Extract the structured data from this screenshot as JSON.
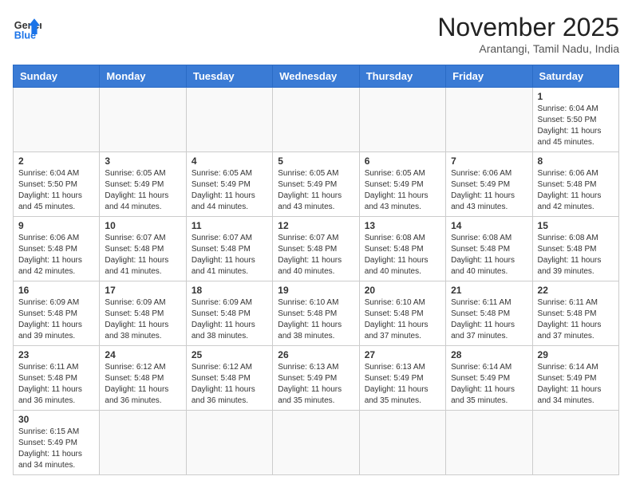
{
  "header": {
    "logo_general": "General",
    "logo_blue": "Blue",
    "month_title": "November 2025",
    "location": "Arantangi, Tamil Nadu, India"
  },
  "days_of_week": [
    "Sunday",
    "Monday",
    "Tuesday",
    "Wednesday",
    "Thursday",
    "Friday",
    "Saturday"
  ],
  "weeks": [
    [
      {
        "day": "",
        "info": ""
      },
      {
        "day": "",
        "info": ""
      },
      {
        "day": "",
        "info": ""
      },
      {
        "day": "",
        "info": ""
      },
      {
        "day": "",
        "info": ""
      },
      {
        "day": "",
        "info": ""
      },
      {
        "day": "1",
        "info": "Sunrise: 6:04 AM\nSunset: 5:50 PM\nDaylight: 11 hours and 45 minutes."
      }
    ],
    [
      {
        "day": "2",
        "info": "Sunrise: 6:04 AM\nSunset: 5:50 PM\nDaylight: 11 hours and 45 minutes."
      },
      {
        "day": "3",
        "info": "Sunrise: 6:05 AM\nSunset: 5:49 PM\nDaylight: 11 hours and 44 minutes."
      },
      {
        "day": "4",
        "info": "Sunrise: 6:05 AM\nSunset: 5:49 PM\nDaylight: 11 hours and 44 minutes."
      },
      {
        "day": "5",
        "info": "Sunrise: 6:05 AM\nSunset: 5:49 PM\nDaylight: 11 hours and 43 minutes."
      },
      {
        "day": "6",
        "info": "Sunrise: 6:05 AM\nSunset: 5:49 PM\nDaylight: 11 hours and 43 minutes."
      },
      {
        "day": "7",
        "info": "Sunrise: 6:06 AM\nSunset: 5:49 PM\nDaylight: 11 hours and 43 minutes."
      },
      {
        "day": "8",
        "info": "Sunrise: 6:06 AM\nSunset: 5:48 PM\nDaylight: 11 hours and 42 minutes."
      }
    ],
    [
      {
        "day": "9",
        "info": "Sunrise: 6:06 AM\nSunset: 5:48 PM\nDaylight: 11 hours and 42 minutes."
      },
      {
        "day": "10",
        "info": "Sunrise: 6:07 AM\nSunset: 5:48 PM\nDaylight: 11 hours and 41 minutes."
      },
      {
        "day": "11",
        "info": "Sunrise: 6:07 AM\nSunset: 5:48 PM\nDaylight: 11 hours and 41 minutes."
      },
      {
        "day": "12",
        "info": "Sunrise: 6:07 AM\nSunset: 5:48 PM\nDaylight: 11 hours and 40 minutes."
      },
      {
        "day": "13",
        "info": "Sunrise: 6:08 AM\nSunset: 5:48 PM\nDaylight: 11 hours and 40 minutes."
      },
      {
        "day": "14",
        "info": "Sunrise: 6:08 AM\nSunset: 5:48 PM\nDaylight: 11 hours and 40 minutes."
      },
      {
        "day": "15",
        "info": "Sunrise: 6:08 AM\nSunset: 5:48 PM\nDaylight: 11 hours and 39 minutes."
      }
    ],
    [
      {
        "day": "16",
        "info": "Sunrise: 6:09 AM\nSunset: 5:48 PM\nDaylight: 11 hours and 39 minutes."
      },
      {
        "day": "17",
        "info": "Sunrise: 6:09 AM\nSunset: 5:48 PM\nDaylight: 11 hours and 38 minutes."
      },
      {
        "day": "18",
        "info": "Sunrise: 6:09 AM\nSunset: 5:48 PM\nDaylight: 11 hours and 38 minutes."
      },
      {
        "day": "19",
        "info": "Sunrise: 6:10 AM\nSunset: 5:48 PM\nDaylight: 11 hours and 38 minutes."
      },
      {
        "day": "20",
        "info": "Sunrise: 6:10 AM\nSunset: 5:48 PM\nDaylight: 11 hours and 37 minutes."
      },
      {
        "day": "21",
        "info": "Sunrise: 6:11 AM\nSunset: 5:48 PM\nDaylight: 11 hours and 37 minutes."
      },
      {
        "day": "22",
        "info": "Sunrise: 6:11 AM\nSunset: 5:48 PM\nDaylight: 11 hours and 37 minutes."
      }
    ],
    [
      {
        "day": "23",
        "info": "Sunrise: 6:11 AM\nSunset: 5:48 PM\nDaylight: 11 hours and 36 minutes."
      },
      {
        "day": "24",
        "info": "Sunrise: 6:12 AM\nSunset: 5:48 PM\nDaylight: 11 hours and 36 minutes."
      },
      {
        "day": "25",
        "info": "Sunrise: 6:12 AM\nSunset: 5:48 PM\nDaylight: 11 hours and 36 minutes."
      },
      {
        "day": "26",
        "info": "Sunrise: 6:13 AM\nSunset: 5:49 PM\nDaylight: 11 hours and 35 minutes."
      },
      {
        "day": "27",
        "info": "Sunrise: 6:13 AM\nSunset: 5:49 PM\nDaylight: 11 hours and 35 minutes."
      },
      {
        "day": "28",
        "info": "Sunrise: 6:14 AM\nSunset: 5:49 PM\nDaylight: 11 hours and 35 minutes."
      },
      {
        "day": "29",
        "info": "Sunrise: 6:14 AM\nSunset: 5:49 PM\nDaylight: 11 hours and 34 minutes."
      }
    ],
    [
      {
        "day": "30",
        "info": "Sunrise: 6:15 AM\nSunset: 5:49 PM\nDaylight: 11 hours and 34 minutes."
      },
      {
        "day": "",
        "info": ""
      },
      {
        "day": "",
        "info": ""
      },
      {
        "day": "",
        "info": ""
      },
      {
        "day": "",
        "info": ""
      },
      {
        "day": "",
        "info": ""
      },
      {
        "day": "",
        "info": ""
      }
    ]
  ]
}
